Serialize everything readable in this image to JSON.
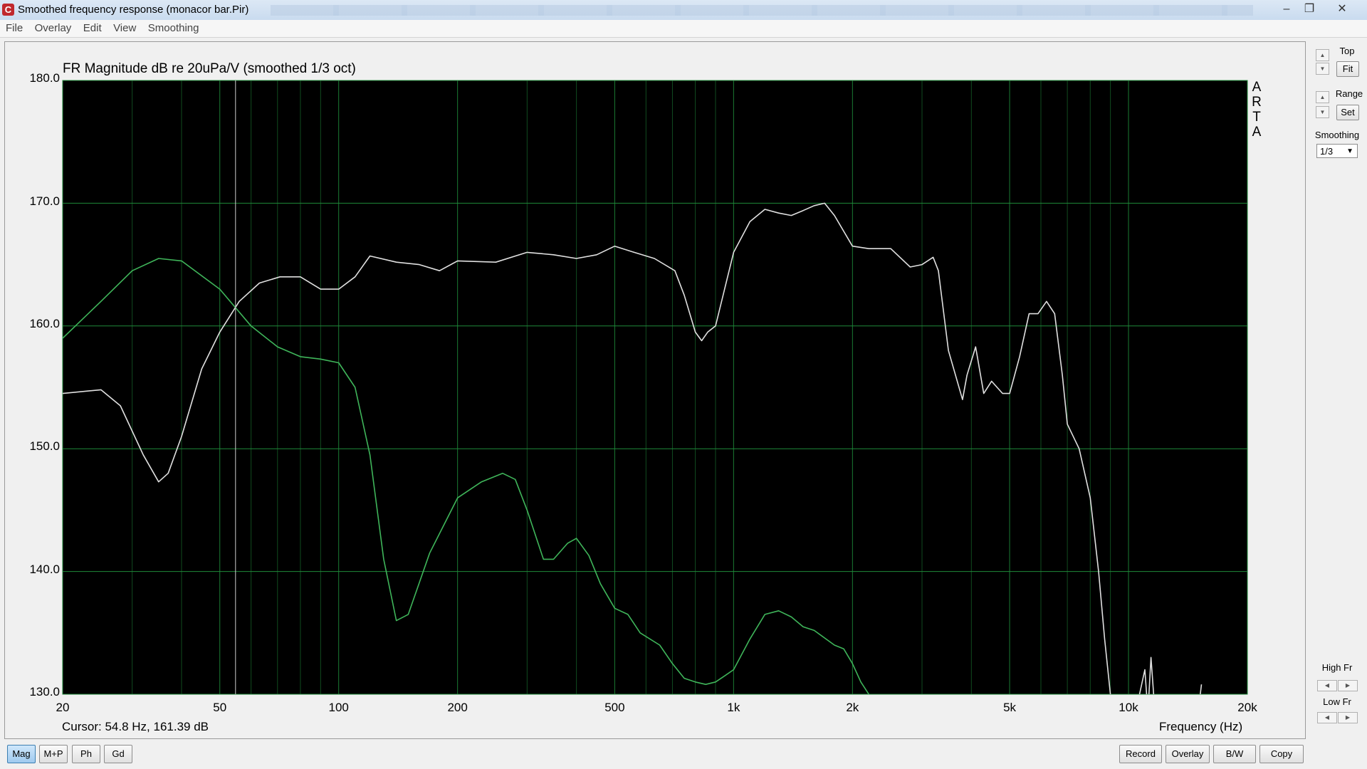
{
  "window": {
    "title": "Smoothed frequency response (monacor bar.Pir)",
    "minimize": "–",
    "maximize": "❐",
    "close": "✕"
  },
  "menu": [
    "File",
    "Overlay",
    "Edit",
    "View",
    "Smoothing"
  ],
  "graph_title": "FR Magnitude dB re 20uPa/V (smoothed 1/3 oct)",
  "watermark": [
    "A",
    "R",
    "T",
    "A"
  ],
  "cursor_readout": "Cursor: 54.8 Hz, 161.39 dB",
  "sidebar": {
    "top_label": "Top",
    "fit_button": "Fit",
    "range_label": "Range",
    "set_button": "Set",
    "smoothing_label": "Smoothing",
    "smoothing_value": "1/3",
    "high_fr_label": "High Fr",
    "low_fr_label": "Low Fr"
  },
  "bottom_left_buttons": [
    "Mag",
    "M+P",
    "Ph",
    "Gd"
  ],
  "bottom_right_buttons": [
    "Record",
    "Overlay",
    "B/W",
    "Copy"
  ],
  "colors": {
    "plot_bg": "#000000",
    "grid": "#1f8a3a",
    "trace_main": "#e0e0e0",
    "trace_overlay": "#3fb55a"
  },
  "chart_data": {
    "type": "line",
    "title": "FR Magnitude dB re 20uPa/V (smoothed 1/3 oct)",
    "xlabel": "Frequency (Hz)",
    "ylabel": "",
    "xscale": "log",
    "xlim": [
      20,
      20000
    ],
    "ylim": [
      130,
      180
    ],
    "x_ticks": [
      20,
      50,
      100,
      200,
      500,
      1000,
      2000,
      5000,
      10000,
      20000
    ],
    "x_tick_labels": [
      "20",
      "50",
      "100",
      "200",
      "500",
      "1k",
      "2k",
      "5k",
      "10k",
      "20k"
    ],
    "y_ticks": [
      130,
      140,
      150,
      160,
      170,
      180
    ],
    "y_tick_labels": [
      "130.0",
      "140.0",
      "150.0",
      "160.0",
      "170.0",
      "180.0"
    ],
    "grid": true,
    "cursor_x": 54.8,
    "series": [
      {
        "color": "#e0e0e0",
        "x": [
          20,
          25,
          28,
          32,
          35,
          37,
          40,
          45,
          50,
          56,
          63,
          71,
          80,
          90,
          100,
          110,
          120,
          140,
          160,
          180,
          200,
          250,
          300,
          350,
          400,
          450,
          500,
          560,
          630,
          710,
          750,
          800,
          830,
          860,
          900,
          1000,
          1100,
          1200,
          1300,
          1400,
          1500,
          1600,
          1700,
          1800,
          2000,
          2200,
          2500,
          2800,
          3000,
          3200,
          3300,
          3500,
          3800,
          3900,
          4100,
          4300,
          4500,
          4800,
          5000,
          5300,
          5600,
          5900,
          6200,
          6500,
          6800,
          7000,
          7500,
          8000,
          8400,
          8700,
          9000,
          9200,
          10500,
          11000,
          11200,
          11400,
          11700,
          15000,
          15300
        ],
        "y": [
          154.5,
          154.8,
          153.5,
          149.5,
          147.3,
          148.0,
          151.0,
          156.5,
          159.5,
          162.0,
          163.5,
          164.0,
          164.0,
          163.0,
          163.0,
          164.0,
          165.7,
          165.2,
          165.0,
          164.5,
          165.3,
          165.2,
          166.0,
          165.8,
          165.5,
          165.8,
          166.5,
          166.0,
          165.5,
          164.5,
          162.5,
          159.5,
          158.8,
          159.5,
          160.0,
          166.0,
          168.5,
          169.5,
          169.2,
          169.0,
          169.4,
          169.8,
          170.0,
          169.0,
          166.5,
          166.3,
          166.3,
          164.8,
          165.0,
          165.6,
          164.5,
          158.0,
          154.0,
          156.0,
          158.3,
          154.5,
          155.5,
          154.5,
          154.5,
          157.5,
          161.0,
          161.0,
          162.0,
          161.0,
          156.0,
          152.0,
          150.0,
          146.0,
          140.0,
          134.5,
          130.0,
          127.0,
          129.0,
          132.0,
          128.5,
          133.0,
          128.0,
          128.5,
          130.8
        ]
      },
      {
        "color": "#3fb55a",
        "x": [
          20,
          25,
          30,
          35,
          40,
          50,
          60,
          70,
          80,
          90,
          100,
          110,
          120,
          130,
          140,
          150,
          170,
          200,
          230,
          260,
          280,
          300,
          330,
          350,
          380,
          400,
          430,
          460,
          500,
          540,
          580,
          650,
          700,
          750,
          800,
          850,
          900,
          950,
          1000,
          1100,
          1200,
          1300,
          1400,
          1500,
          1600,
          1800,
          1900,
          2000,
          2100,
          2200
        ],
        "y": [
          159.0,
          162.0,
          164.5,
          165.5,
          165.3,
          163.0,
          160.0,
          158.3,
          157.5,
          157.3,
          157.0,
          155.0,
          149.5,
          141.0,
          136.0,
          136.5,
          141.5,
          146.0,
          147.3,
          148.0,
          147.5,
          145.0,
          141.0,
          141.0,
          142.3,
          142.7,
          141.3,
          139.0,
          137.0,
          136.5,
          135.0,
          134.0,
          132.5,
          131.3,
          131.0,
          130.8,
          131.0,
          131.5,
          132.0,
          134.5,
          136.5,
          136.8,
          136.3,
          135.5,
          135.2,
          134.0,
          133.7,
          132.5,
          131.0,
          130.0
        ]
      }
    ]
  }
}
